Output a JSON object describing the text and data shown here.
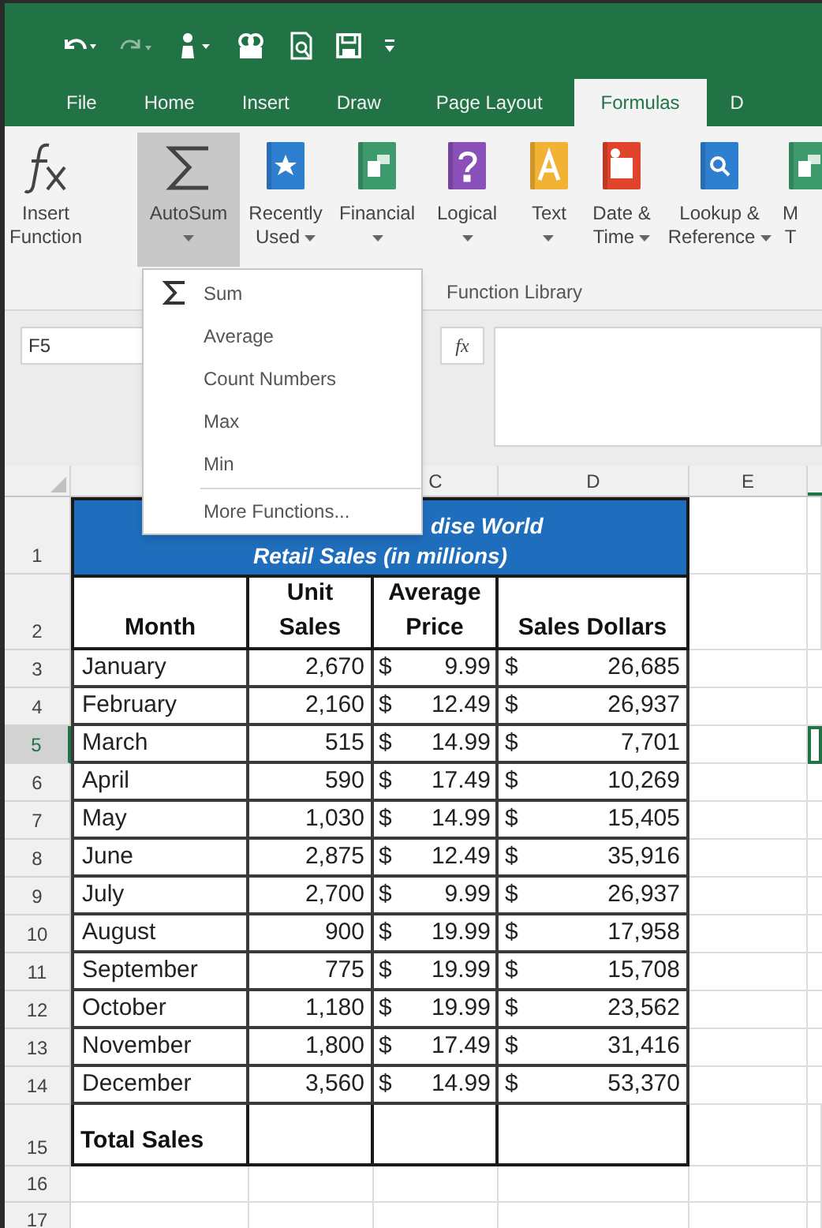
{
  "tabs": [
    {
      "label": "File",
      "selected": false
    },
    {
      "label": "Home",
      "selected": false
    },
    {
      "label": "Insert",
      "selected": false
    },
    {
      "label": "Draw",
      "selected": false
    },
    {
      "label": "Page Layout",
      "selected": false
    },
    {
      "label": "Formulas",
      "selected": true
    },
    {
      "label": "D",
      "selected": false
    }
  ],
  "ribbon": {
    "buttons": [
      {
        "kind": "fx",
        "lines": [
          "Insert",
          "Function"
        ],
        "dropdown": false,
        "pressed": false
      },
      {
        "kind": "sigma",
        "lines": [
          "AutoSum"
        ],
        "dropdown": true,
        "pressed": true
      },
      {
        "kind": "book",
        "color": "#2f7fd0",
        "lines": [
          "Recently",
          "Used"
        ],
        "dropdown": true,
        "pressed": false
      },
      {
        "kind": "book",
        "color": "#3d9a6c",
        "lines": [
          "Financial"
        ],
        "dropdown": true,
        "pressed": false
      },
      {
        "kind": "book",
        "color": "#8a4fb8",
        "lines": [
          "Logical"
        ],
        "dropdown": true,
        "pressed": false
      },
      {
        "kind": "book",
        "color": "#f2b233",
        "lines": [
          "Text"
        ],
        "dropdown": true,
        "pressed": false
      },
      {
        "kind": "book",
        "color": "#e0452b",
        "lines": [
          "Date &",
          "Time"
        ],
        "dropdown": true,
        "pressed": false
      },
      {
        "kind": "book",
        "color": "#2f7fd0",
        "lines": [
          "Lookup &",
          "Reference"
        ],
        "dropdown": true,
        "pressed": false
      },
      {
        "kind": "book",
        "color": "#3d9a6c",
        "lines": [
          "M",
          "T"
        ],
        "dropdown": false,
        "pressed": false
      }
    ],
    "group_label": "Function Library"
  },
  "autosum_menu": {
    "items": [
      {
        "kind": "sigma",
        "label": "Sum"
      },
      {
        "kind": "plain",
        "label": "Average"
      },
      {
        "kind": "plain",
        "label": "Count Numbers"
      },
      {
        "kind": "plain",
        "label": "Max"
      },
      {
        "kind": "plain",
        "label": "Min"
      },
      {
        "kind": "separated",
        "label": "More Functions..."
      }
    ]
  },
  "formula_bar": {
    "name_box": "F5",
    "function_label": "fx"
  },
  "column_headers": [
    {
      "label": "C"
    },
    {
      "label": "D"
    },
    {
      "label": "E"
    }
  ],
  "row_headers": [
    {
      "label": "1",
      "selected": false
    },
    {
      "label": "2",
      "selected": false
    },
    {
      "label": "3",
      "selected": false
    },
    {
      "label": "4",
      "selected": false
    },
    {
      "label": "5",
      "selected": true
    },
    {
      "label": "6",
      "selected": false
    },
    {
      "label": "7",
      "selected": false
    },
    {
      "label": "8",
      "selected": false
    },
    {
      "label": "9",
      "selected": false
    },
    {
      "label": "10",
      "selected": false
    },
    {
      "label": "11",
      "selected": false
    },
    {
      "label": "12",
      "selected": false
    },
    {
      "label": "13",
      "selected": false
    },
    {
      "label": "14",
      "selected": false
    },
    {
      "label": "15",
      "selected": false
    },
    {
      "label": "16",
      "selected": false
    },
    {
      "label": "17",
      "selected": false
    }
  ],
  "sheet": {
    "title_lines": [
      "dise World",
      "Retail Sales (in millions)"
    ],
    "headers": [
      [
        "Month"
      ],
      [
        "Unit",
        "Sales"
      ],
      [
        "Average",
        "Price"
      ],
      [
        "Sales Dollars"
      ]
    ],
    "rows": [
      {
        "month": "January",
        "units": "2,670",
        "price_symbol": "$",
        "price": "9.99",
        "sales_symbol": "$",
        "sales": "26,685"
      },
      {
        "month": "February",
        "units": "2,160",
        "price_symbol": "$",
        "price": "12.49",
        "sales_symbol": "$",
        "sales": "26,937"
      },
      {
        "month": "March",
        "units": "515",
        "price_symbol": "$",
        "price": "14.99",
        "sales_symbol": "$",
        "sales": "7,701"
      },
      {
        "month": "April",
        "units": "590",
        "price_symbol": "$",
        "price": "17.49",
        "sales_symbol": "$",
        "sales": "10,269"
      },
      {
        "month": "May",
        "units": "1,030",
        "price_symbol": "$",
        "price": "14.99",
        "sales_symbol": "$",
        "sales": "15,405"
      },
      {
        "month": "June",
        "units": "2,875",
        "price_symbol": "$",
        "price": "12.49",
        "sales_symbol": "$",
        "sales": "35,916"
      },
      {
        "month": "July",
        "units": "2,700",
        "price_symbol": "$",
        "price": "9.99",
        "sales_symbol": "$",
        "sales": "26,937"
      },
      {
        "month": "August",
        "units": "900",
        "price_symbol": "$",
        "price": "19.99",
        "sales_symbol": "$",
        "sales": "17,958"
      },
      {
        "month": "September",
        "units": "775",
        "price_symbol": "$",
        "price": "19.99",
        "sales_symbol": "$",
        "sales": "15,708"
      },
      {
        "month": "October",
        "units": "1,180",
        "price_symbol": "$",
        "price": "19.99",
        "sales_symbol": "$",
        "sales": "23,562"
      },
      {
        "month": "November",
        "units": "1,800",
        "price_symbol": "$",
        "price": "17.49",
        "sales_symbol": "$",
        "sales": "31,416"
      },
      {
        "month": "December",
        "units": "3,560",
        "price_symbol": "$",
        "price": "14.99",
        "sales_symbol": "$",
        "sales": "53,370"
      }
    ],
    "total_label": "Total Sales"
  }
}
